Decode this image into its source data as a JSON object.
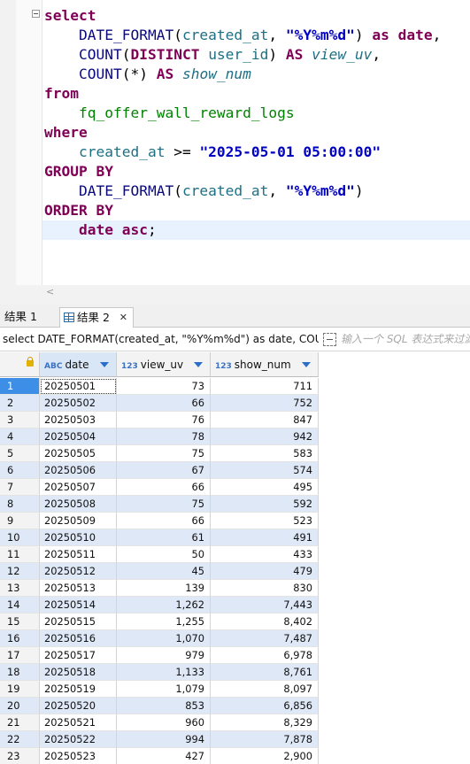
{
  "editor": {
    "lines": [
      {
        "parts": [
          {
            "t": "select",
            "c": "k"
          }
        ]
      },
      {
        "parts": [
          {
            "t": "    ",
            "c": ""
          },
          {
            "t": "DATE_FORMAT",
            "c": "f"
          },
          {
            "t": "(",
            "c": ""
          },
          {
            "t": "created_at",
            "c": "i"
          },
          {
            "t": ", ",
            "c": ""
          },
          {
            "t": "\"%Y%m%d\"",
            "c": "s"
          },
          {
            "t": ") ",
            "c": ""
          },
          {
            "t": "as",
            "c": "k"
          },
          {
            "t": " ",
            "c": ""
          },
          {
            "t": "date",
            "c": "k"
          },
          {
            "t": ",",
            "c": ""
          }
        ]
      },
      {
        "parts": [
          {
            "t": "    ",
            "c": ""
          },
          {
            "t": "COUNT",
            "c": "f"
          },
          {
            "t": "(",
            "c": ""
          },
          {
            "t": "DISTINCT",
            "c": "k"
          },
          {
            "t": " ",
            "c": ""
          },
          {
            "t": "user_id",
            "c": "i"
          },
          {
            "t": ") ",
            "c": ""
          },
          {
            "t": "AS",
            "c": "k"
          },
          {
            "t": " ",
            "c": ""
          },
          {
            "t": "view_uv",
            "c": "it"
          },
          {
            "t": ",",
            "c": ""
          }
        ]
      },
      {
        "parts": [
          {
            "t": "    ",
            "c": ""
          },
          {
            "t": "COUNT",
            "c": "f"
          },
          {
            "t": "(*) ",
            "c": ""
          },
          {
            "t": "AS",
            "c": "k"
          },
          {
            "t": " ",
            "c": ""
          },
          {
            "t": "show_num",
            "c": "it"
          }
        ]
      },
      {
        "parts": [
          {
            "t": "from",
            "c": "k"
          }
        ]
      },
      {
        "parts": [
          {
            "t": "    ",
            "c": ""
          },
          {
            "t": "fq_offer_wall_reward_logs",
            "c": "t"
          }
        ]
      },
      {
        "parts": [
          {
            "t": "where",
            "c": "k"
          }
        ]
      },
      {
        "parts": [
          {
            "t": "    ",
            "c": ""
          },
          {
            "t": "created_at",
            "c": "i"
          },
          {
            "t": " >= ",
            "c": ""
          },
          {
            "t": "\"2025-05-01 05:00:00\"",
            "c": "s"
          }
        ]
      },
      {
        "parts": [
          {
            "t": "GROUP BY",
            "c": "k"
          }
        ]
      },
      {
        "parts": [
          {
            "t": "    ",
            "c": ""
          },
          {
            "t": "DATE_FORMAT",
            "c": "f"
          },
          {
            "t": "(",
            "c": ""
          },
          {
            "t": "created_at",
            "c": "i"
          },
          {
            "t": ", ",
            "c": ""
          },
          {
            "t": "\"%Y%m%d\"",
            "c": "s"
          },
          {
            "t": ")",
            "c": ""
          }
        ]
      },
      {
        "parts": [
          {
            "t": "ORDER BY",
            "c": "k"
          }
        ]
      },
      {
        "parts": [
          {
            "t": "    ",
            "c": ""
          },
          {
            "t": "date",
            "c": "k"
          },
          {
            "t": " ",
            "c": ""
          },
          {
            "t": "asc",
            "c": "k"
          },
          {
            "t": ";",
            "c": ""
          }
        ]
      }
    ],
    "scroll_left_arrow": "<"
  },
  "tabs": [
    {
      "label": "结果 1"
    },
    {
      "label": "结果 2",
      "close": "✕"
    }
  ],
  "filter": {
    "sql_text": "select DATE_FORMAT(created_at, \"%Y%m%d\") as date, COUNT(DISTINCT user_id) AS view_uv",
    "placeholder": "输入一个 SQL 表达式来过滤结果"
  },
  "table": {
    "columns": [
      {
        "type": "ABC",
        "name": "date"
      },
      {
        "type": "123",
        "name": "view_uv"
      },
      {
        "type": "123",
        "name": "show_num"
      }
    ],
    "rows": [
      [
        "1",
        "20250501",
        "73",
        "711"
      ],
      [
        "2",
        "20250502",
        "66",
        "752"
      ],
      [
        "3",
        "20250503",
        "76",
        "847"
      ],
      [
        "4",
        "20250504",
        "78",
        "942"
      ],
      [
        "5",
        "20250505",
        "75",
        "583"
      ],
      [
        "6",
        "20250506",
        "67",
        "574"
      ],
      [
        "7",
        "20250507",
        "66",
        "495"
      ],
      [
        "8",
        "20250508",
        "75",
        "592"
      ],
      [
        "9",
        "20250509",
        "66",
        "523"
      ],
      [
        "10",
        "20250510",
        "61",
        "491"
      ],
      [
        "11",
        "20250511",
        "50",
        "433"
      ],
      [
        "12",
        "20250512",
        "45",
        "479"
      ],
      [
        "13",
        "20250513",
        "139",
        "830"
      ],
      [
        "14",
        "20250514",
        "1,262",
        "7,443"
      ],
      [
        "15",
        "20250515",
        "1,255",
        "8,402"
      ],
      [
        "16",
        "20250516",
        "1,070",
        "7,487"
      ],
      [
        "17",
        "20250517",
        "979",
        "6,978"
      ],
      [
        "18",
        "20250518",
        "1,133",
        "8,761"
      ],
      [
        "19",
        "20250519",
        "1,079",
        "8,097"
      ],
      [
        "20",
        "20250520",
        "853",
        "6,856"
      ],
      [
        "21",
        "20250521",
        "960",
        "8,329"
      ],
      [
        "22",
        "20250522",
        "994",
        "7,878"
      ],
      [
        "23",
        "20250523",
        "427",
        "2,900"
      ]
    ]
  }
}
